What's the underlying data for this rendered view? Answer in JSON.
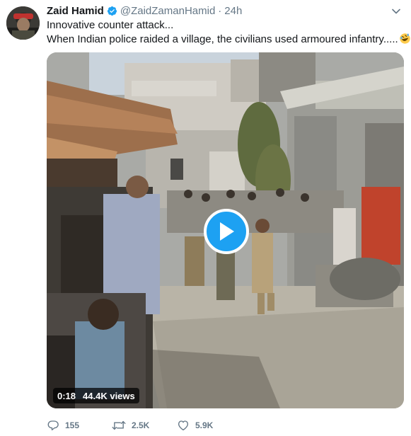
{
  "tweet": {
    "author_name": "Zaid Hamid",
    "author_handle": "@ZaidZamanHamid",
    "separator": "·",
    "time": "24h",
    "text_line1": "Innovative counter attack...",
    "text_line2": "When Indian police raided a village, the civilians used armoured infantry.....",
    "emoji": "rolling-on-floor-laughing-emoji"
  },
  "video": {
    "duration": "0:18",
    "views": "44.4K views"
  },
  "actions": {
    "reply_count": "155",
    "retweet_count": "2.5K",
    "like_count": "5.9K"
  },
  "colors": {
    "accent": "#1da1f2",
    "muted": "#657786",
    "text": "#14171a"
  }
}
